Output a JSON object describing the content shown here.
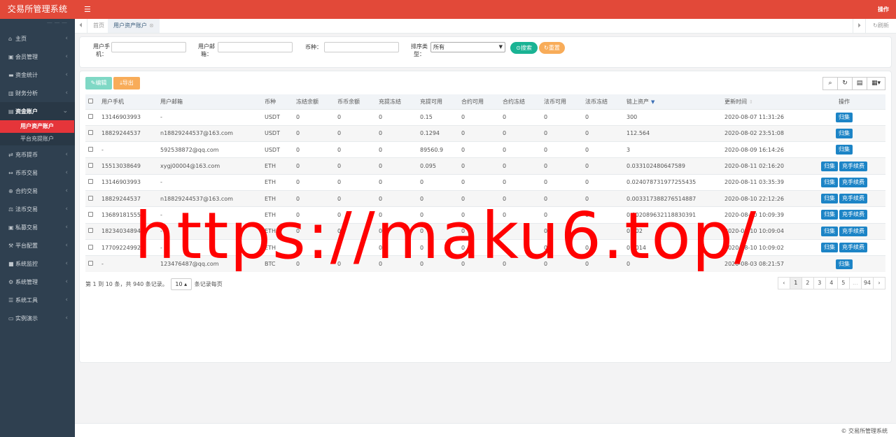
{
  "app": {
    "title": "交易所管理系统",
    "top_right": "操作",
    "footer": "© 交易所管理系统"
  },
  "sidebar": {
    "items": [
      {
        "icon": "home-icon",
        "glyph": "⌂",
        "label": "主页"
      },
      {
        "icon": "user-icon",
        "glyph": "▣",
        "label": "会员管理"
      },
      {
        "icon": "money-icon",
        "glyph": "▬",
        "label": "资金统计"
      },
      {
        "icon": "bar-chart-icon",
        "glyph": "▥",
        "label": "财务分析"
      },
      {
        "icon": "wallet-icon",
        "glyph": "▤",
        "label": "资金账户"
      },
      {
        "icon": "transfer-icon",
        "glyph": "⇄",
        "label": "充币提币"
      },
      {
        "icon": "exchange-icon",
        "glyph": "↔",
        "label": "币币交易"
      },
      {
        "icon": "contract-icon",
        "glyph": "⊕",
        "label": "合约交易"
      },
      {
        "icon": "fiat-icon",
        "glyph": "⚖",
        "label": "法币交易"
      },
      {
        "icon": "private-icon",
        "glyph": "▣",
        "label": "私募交易"
      },
      {
        "icon": "config-icon",
        "glyph": "⚒",
        "label": "平台配置"
      },
      {
        "icon": "monitor-icon",
        "glyph": "■",
        "label": "系统监控"
      },
      {
        "icon": "gear-icon",
        "glyph": "⚙",
        "label": "系统管理"
      },
      {
        "icon": "tools-icon",
        "glyph": "☰",
        "label": "系统工具"
      },
      {
        "icon": "demo-icon",
        "glyph": "▭",
        "label": "实例演示"
      }
    ],
    "sub_items": [
      "用户资产账户",
      "平台充提账户"
    ]
  },
  "tabs": {
    "home": "首页",
    "current": "用户资产账户",
    "refresh": "刷新"
  },
  "filters": {
    "phone_label_1": "用户手",
    "phone_label_2": "机：",
    "email_label_1": "用户邮",
    "email_label_2": "箱：",
    "coin_label": "币种：",
    "sort_label_1": "排序类",
    "sort_label_2": "型：",
    "sort_value": "所有",
    "search": "搜索",
    "reset": "重置"
  },
  "toolbar": {
    "edit": "编辑",
    "export": "导出"
  },
  "table": {
    "headers": [
      "用户手机",
      "用户邮箱",
      "币种",
      "冻结余额",
      "币币余额",
      "充提冻结",
      "充提可用",
      "合约可用",
      "合约冻结",
      "法币可用",
      "法币冻结",
      "链上资产",
      "更新时间",
      "操作"
    ],
    "rows": [
      {
        "phone": "13146903993",
        "email": "-",
        "coin": "USDT",
        "c1": "0",
        "c2": "0",
        "c3": "0",
        "c4": "0.15",
        "c5": "0",
        "c6": "0",
        "c7": "0",
        "c8": "0",
        "chain": "300",
        "time": "2020-08-07 11:31:26",
        "ops": [
          "归集"
        ]
      },
      {
        "phone": "18829244537",
        "email": "n18829244537@163.com",
        "coin": "USDT",
        "c1": "0",
        "c2": "0",
        "c3": "0",
        "c4": "0.1294",
        "c5": "0",
        "c6": "0",
        "c7": "0",
        "c8": "0",
        "chain": "112.564",
        "time": "2020-08-02 23:51:08",
        "ops": [
          "归集"
        ]
      },
      {
        "phone": "-",
        "email": "592538872@qq.com",
        "coin": "USDT",
        "c1": "0",
        "c2": "0",
        "c3": "0",
        "c4": "89560.9",
        "c5": "0",
        "c6": "0",
        "c7": "0",
        "c8": "0",
        "chain": "3",
        "time": "2020-08-09 16:14:26",
        "ops": [
          "归集"
        ]
      },
      {
        "phone": "15513038649",
        "email": "xygj00004@163.com",
        "coin": "ETH",
        "c1": "0",
        "c2": "0",
        "c3": "0",
        "c4": "0.095",
        "c5": "0",
        "c6": "0",
        "c7": "0",
        "c8": "0",
        "chain": "0.033102480647589",
        "time": "2020-08-11 02:16:20",
        "ops": [
          "归集",
          "充手续费"
        ]
      },
      {
        "phone": "13146903993",
        "email": "-",
        "coin": "ETH",
        "c1": "0",
        "c2": "0",
        "c3": "0",
        "c4": "0",
        "c5": "0",
        "c6": "0",
        "c7": "0",
        "c8": "0",
        "chain": "0.024078731977255435",
        "time": "2020-08-11 03:35:39",
        "ops": [
          "归集",
          "充手续费"
        ]
      },
      {
        "phone": "18829244537",
        "email": "n18829244537@163.com",
        "coin": "ETH",
        "c1": "0",
        "c2": "0",
        "c3": "0",
        "c4": "0",
        "c5": "0",
        "c6": "0",
        "c7": "0",
        "c8": "0",
        "chain": "0.003317388276514887",
        "time": "2020-08-10 22:12:26",
        "ops": [
          "归集",
          "充手续费"
        ]
      },
      {
        "phone": "13689181555",
        "email": "-",
        "coin": "ETH",
        "c1": "0",
        "c2": "0",
        "c3": "0",
        "c4": "0",
        "c5": "0",
        "c6": "0",
        "c7": "0",
        "c8": "0",
        "chain": "0.002089632118830391",
        "time": "2020-08-10 10:09:39",
        "ops": [
          "归集",
          "充手续费"
        ]
      },
      {
        "phone": "18234034894",
        "email": "-",
        "coin": "ETH",
        "c1": "0",
        "c2": "0",
        "c3": "0",
        "c4": "0",
        "c5": "0",
        "c6": "0",
        "c7": "0",
        "c8": "0",
        "chain": "0.002",
        "time": "2020-08-10 10:09:04",
        "ops": [
          "归集",
          "充手续费"
        ]
      },
      {
        "phone": "17709224992",
        "email": "-",
        "coin": "ETH",
        "c1": "0",
        "c2": "0",
        "c3": "0",
        "c4": "0",
        "c5": "0",
        "c6": "0",
        "c7": "0",
        "c8": "0",
        "chain": "0.0014",
        "time": "2020-08-10 10:09:02",
        "ops": [
          "归集",
          "充手续费"
        ]
      },
      {
        "phone": "-",
        "email": "123476487@qq.com",
        "coin": "BTC",
        "c1": "0",
        "c2": "0",
        "c3": "0",
        "c4": "0",
        "c5": "0",
        "c6": "0",
        "c7": "0",
        "c8": "0",
        "chain": "0",
        "time": "2020-08-03 08:21:57",
        "ops": [
          "归集"
        ]
      }
    ]
  },
  "pagination": {
    "info_prefix": "第 1 到 10 条，共 940 条记录。",
    "page_size": "10",
    "info_suffix": "条记录每页",
    "pages": [
      "‹",
      "1",
      "2",
      "3",
      "4",
      "5",
      "...",
      "94",
      "›"
    ],
    "current": "1"
  },
  "watermark": "https://maku6.top/"
}
